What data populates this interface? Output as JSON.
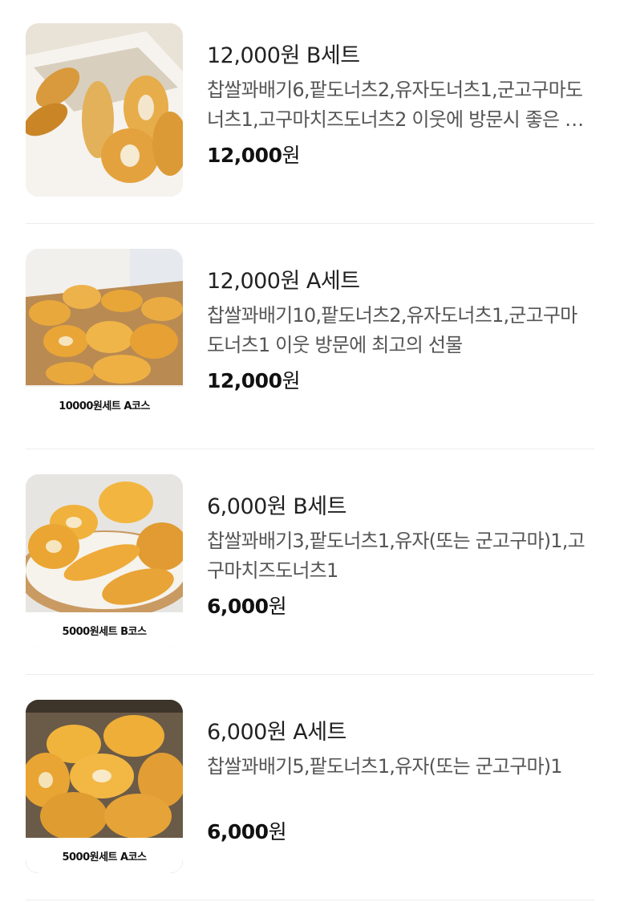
{
  "items": [
    {
      "title": "12,000원 B세트",
      "description": "찹쌀꽈배기6,팥도너츠2,유자도너츠1,군고구마도너츠1,고구마치즈도너츠2 이웃에 방문시 좋은 선물",
      "price_value": "12,000",
      "price_unit": "원",
      "thumb_caption": ""
    },
    {
      "title": "12,000원 A세트",
      "description": "찹쌀꽈배기10,팥도너츠2,유자도너츠1,군고구마도너츠1 이웃 방문에 최고의 선물",
      "price_value": "12,000",
      "price_unit": "원",
      "thumb_caption": "10000원세트 A코스"
    },
    {
      "title": "6,000원 B세트",
      "description": "찹쌀꽈배기3,팥도너츠1,유자(또는 군고구마)1,고구마치즈도너츠1",
      "price_value": "6,000",
      "price_unit": "원",
      "thumb_caption": "5000원세트 B코스"
    },
    {
      "title": "6,000원 A세트",
      "description": "찹쌀꽈배기5,팥도너츠1,유자(또는 군고구마)1",
      "price_value": "6,000",
      "price_unit": "원",
      "thumb_caption": "5000원세트 A코스"
    }
  ]
}
